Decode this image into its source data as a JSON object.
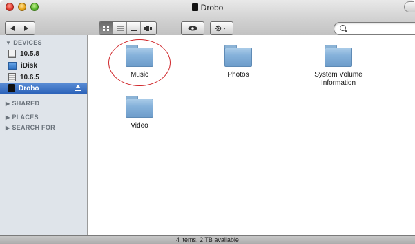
{
  "window": {
    "title": "Drobo"
  },
  "sidebar": {
    "devices_header": "DEVICES",
    "devices": [
      {
        "label": "10.5.8",
        "icon": "hard-disk-icon"
      },
      {
        "label": "iDisk",
        "icon": "idisk-icon"
      },
      {
        "label": "10.6.5",
        "icon": "hard-disk-icon"
      },
      {
        "label": "Drobo",
        "icon": "drobo-icon",
        "selected": true
      }
    ],
    "sections": [
      "SHARED",
      "PLACES",
      "SEARCH FOR"
    ]
  },
  "content": {
    "items": [
      {
        "label": "Music"
      },
      {
        "label": "Photos"
      },
      {
        "label": "System Volume Information"
      },
      {
        "label": "Video"
      }
    ]
  },
  "status": {
    "text": "4 items, 2 TB available"
  },
  "colors": {
    "selection": "#2b62b9",
    "annotation": "#d0262a",
    "folder": "#85b1da"
  }
}
